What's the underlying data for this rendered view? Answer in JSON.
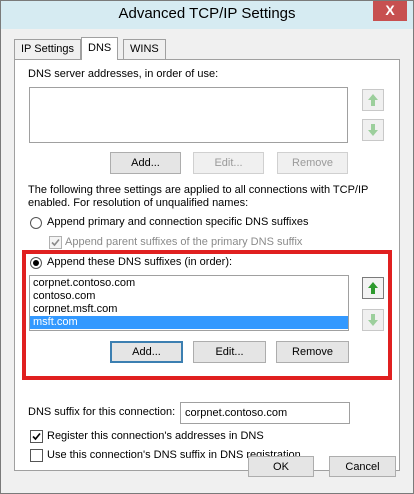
{
  "window": {
    "title": "Advanced TCP/IP Settings",
    "close_glyph": "X"
  },
  "tabs": [
    {
      "label": "IP Settings",
      "active": false
    },
    {
      "label": "DNS",
      "active": true
    },
    {
      "label": "WINS",
      "active": false
    }
  ],
  "dns_servers": {
    "label": "DNS server addresses, in order of use:",
    "items": [],
    "add_label": "Add...",
    "edit_label": "Edit...",
    "remove_label": "Remove"
  },
  "settings_note": "The following three settings are applied to all connections with TCP/IP enabled. For resolution of unqualified names:",
  "note_line1": "The following three settings are applied to all connections with TCP/IP",
  "note_line2": "enabled. For resolution of unqualified names:",
  "radio_primary": {
    "label": "Append primary and connection specific DNS suffixes",
    "selected": false
  },
  "check_parent": {
    "label": "Append parent suffixes of the primary DNS suffix",
    "checked": true,
    "enabled": false
  },
  "radio_suffixes": {
    "label": "Append these DNS suffixes (in order):",
    "selected": true
  },
  "suffixes": {
    "items": [
      "corpnet.contoso.com",
      "contoso.com",
      "corpnet.msft.com",
      "msft.com"
    ],
    "selected_index": 3,
    "add_label": "Add...",
    "edit_label": "Edit...",
    "remove_label": "Remove"
  },
  "dns_suffix": {
    "label": "DNS suffix for this connection:",
    "value": "corpnet.contoso.com"
  },
  "check_register": {
    "label": "Register this connection's addresses in DNS",
    "checked": true
  },
  "check_use_suffix": {
    "label": "Use this connection's DNS suffix in DNS registration",
    "checked": false
  },
  "footer": {
    "ok_label": "OK",
    "cancel_label": "Cancel"
  },
  "colors": {
    "highlight": "#e02020",
    "selection": "#3399ff",
    "arrow_enabled": "#2e9a2e",
    "arrow_disabled": "#9ccf9c"
  }
}
